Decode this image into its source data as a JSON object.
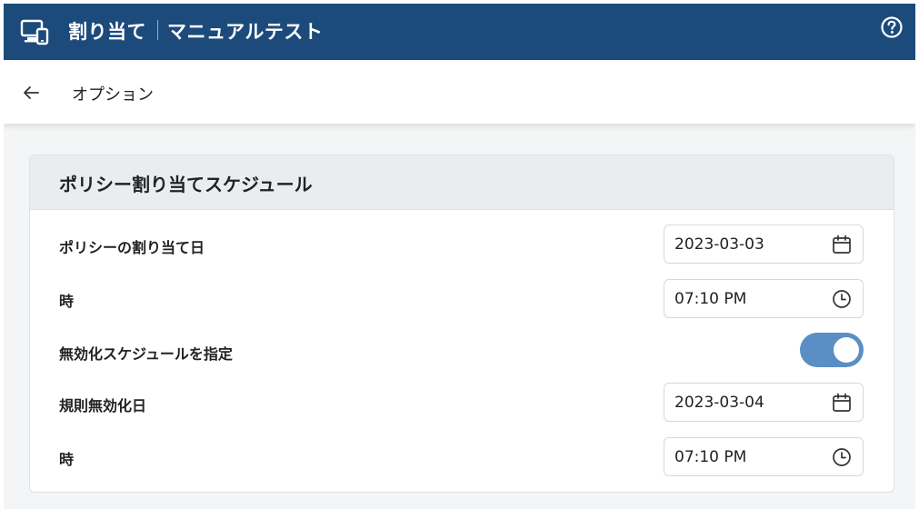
{
  "header": {
    "title": "割り当て",
    "subtitle": "マニュアルテスト",
    "app_icon": "devices-icon",
    "help_icon": "help-circle-icon",
    "color": "#1c4b7b"
  },
  "subheader": {
    "back_icon": "arrow-left-icon",
    "title": "オプション"
  },
  "card": {
    "title": "ポリシー割り当てスケジュール",
    "rows": [
      {
        "label": "ポリシーの割り当て日",
        "value": "2023-03-03",
        "icon": "calendar-icon"
      },
      {
        "label": "時",
        "value": "07:10 PM",
        "icon": "clock-icon"
      },
      {
        "label": "無効化スケジュールを指定",
        "toggle_on": true
      },
      {
        "label": "規則無効化日",
        "value": "2023-03-04",
        "icon": "calendar-icon"
      },
      {
        "label": "時",
        "value": "07:10 PM",
        "icon": "clock-icon"
      }
    ]
  },
  "colors": {
    "toggle_on": "#5a8fc5",
    "header_bg": "#eaedef"
  }
}
